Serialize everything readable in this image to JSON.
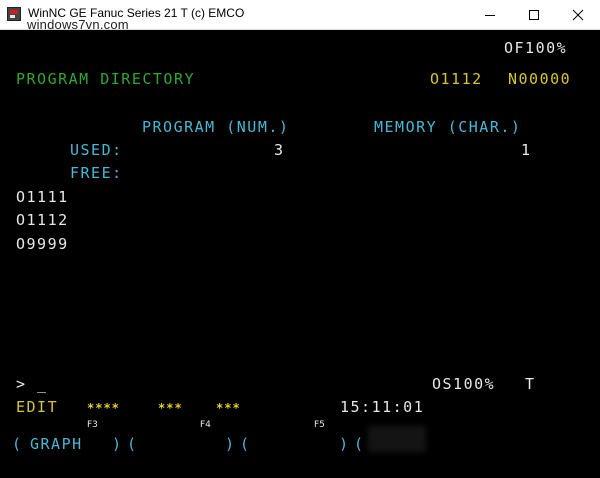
{
  "window": {
    "title": "WinNC GE Fanuc Series 21 T (c) EMCO",
    "watermark": "windows7vn.com"
  },
  "header": {
    "override": "OF100%",
    "screen_title": "PROGRAM DIRECTORY",
    "current_program": "O1112",
    "sequence_number": "N00000"
  },
  "directory": {
    "program_col_label": "PROGRAM (NUM.)",
    "memory_col_label": "MEMORY (CHAR.)",
    "used_label": "USED:",
    "free_label": "FREE:",
    "used_programs": "3",
    "used_memory": "1",
    "programs": [
      "O1111",
      "O1112",
      "O9999"
    ]
  },
  "status": {
    "prompt": "> _",
    "spindle_override": "OS100%",
    "machine_type": "T",
    "mode": "EDIT",
    "stars_1": "****",
    "stars_2": "***",
    "stars_3": "***",
    "time": "15:11:01"
  },
  "softkeys": {
    "f3_label": "F3",
    "f4_label": "F4",
    "f5_label": "F5",
    "key1_open": "(",
    "key1_text": "GRAPH",
    "key1_close": ")",
    "key2_open": "(",
    "key2_text": "",
    "key2_close": ")",
    "key3_open": "(",
    "key3_text": "",
    "key3_close": ")",
    "key4_open": "("
  },
  "colors": {
    "background": "#000000",
    "green": "#2fa82f",
    "yellow": "#d8c52a",
    "cyan": "#48b8d4",
    "white": "#e8e8e8"
  }
}
